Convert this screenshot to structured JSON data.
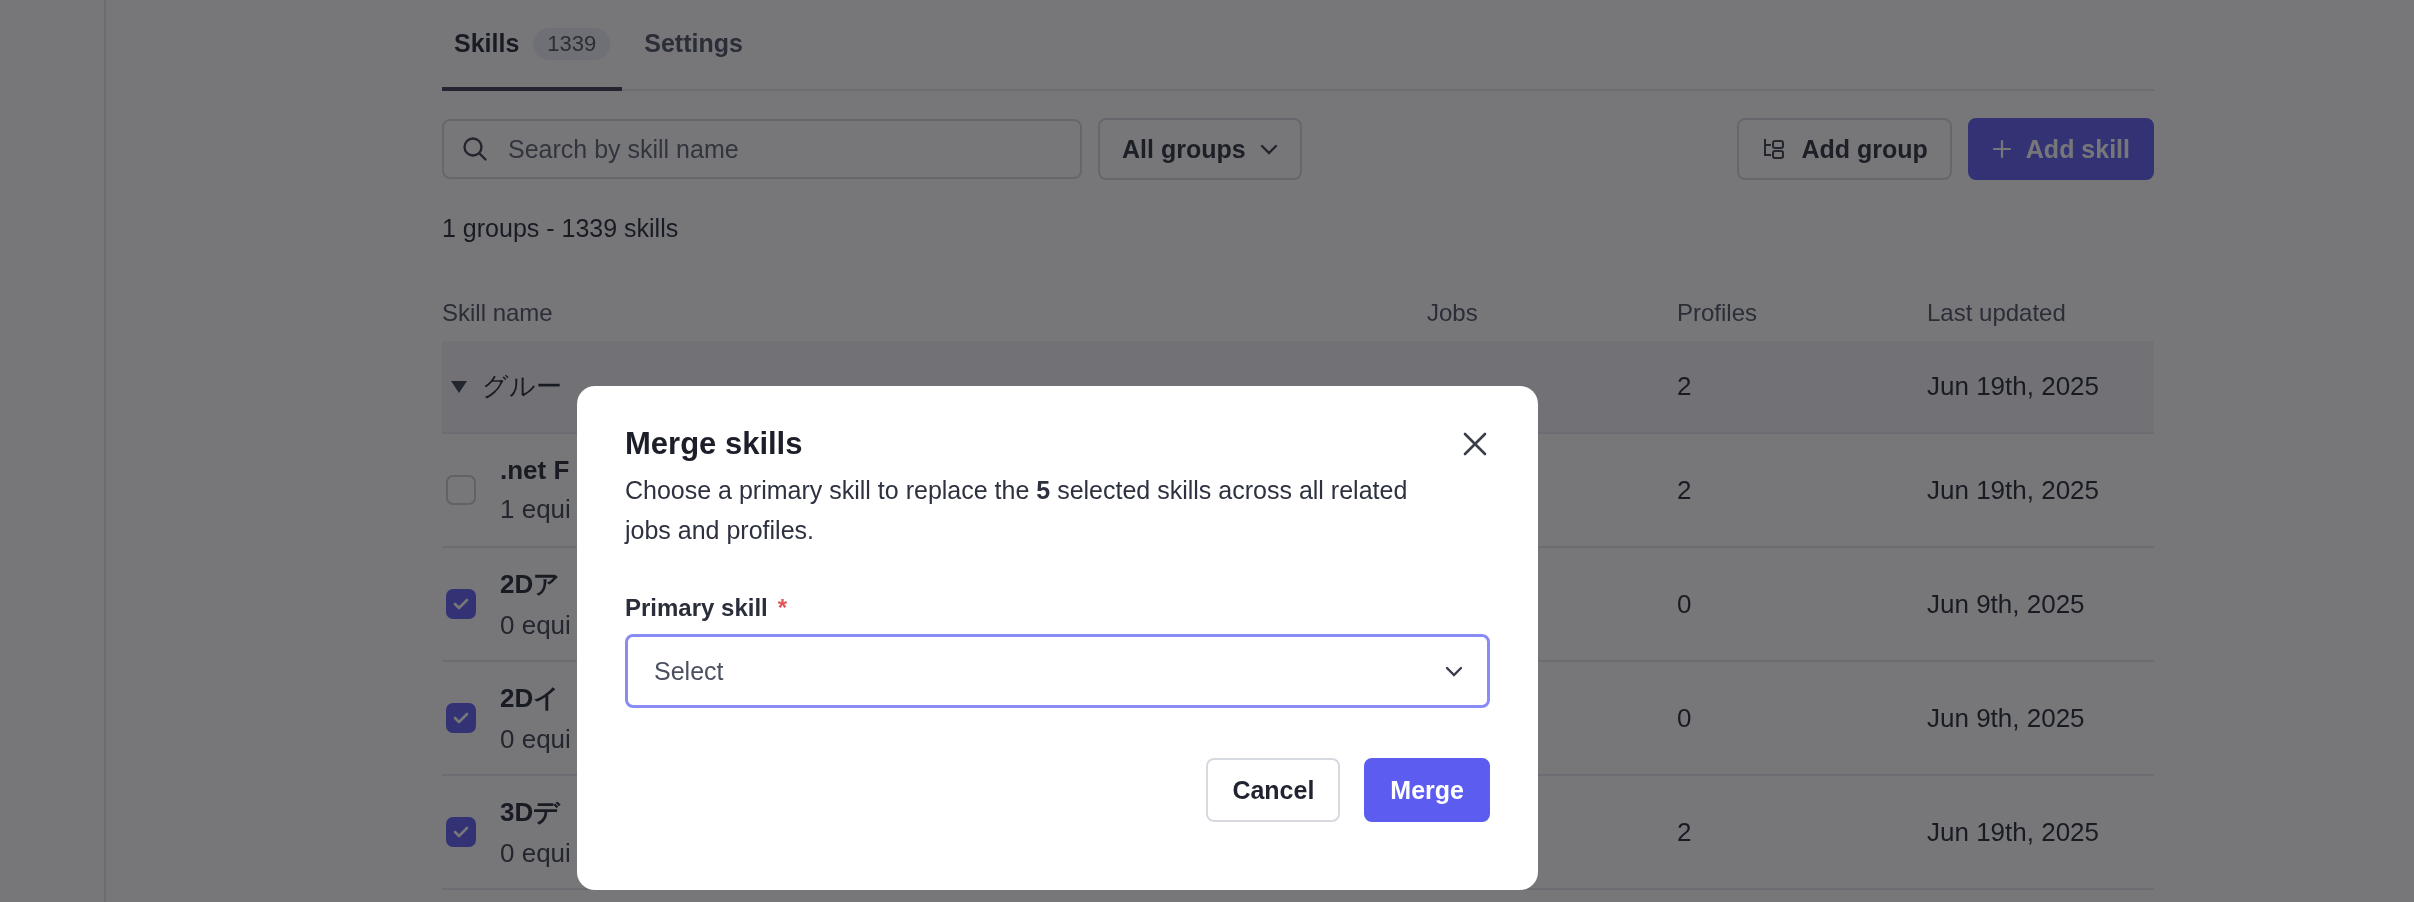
{
  "tabs": [
    {
      "label": "Skills",
      "badge": "1339",
      "selected": true
    },
    {
      "label": "Settings",
      "selected": false
    }
  ],
  "toolbar": {
    "search": {
      "placeholder": "Search by skill name"
    },
    "group_filter": "All groups",
    "add_group": "Add group",
    "add_skill": "Add skill"
  },
  "summary": "1 groups - 1339 skills",
  "table": {
    "columns": [
      "Skill name",
      "Jobs",
      "Profiles",
      "Last updated"
    ],
    "group": {
      "name": "グルー",
      "expanded": true,
      "profiles": "2",
      "last_updated": "Jun 19th, 2025"
    },
    "rows": [
      {
        "name": ".net F",
        "sub": "1 equi",
        "checked": false,
        "profiles": "2",
        "last_updated": "Jun 19th, 2025"
      },
      {
        "name": "2Dア",
        "sub": "0 equi",
        "checked": true,
        "profiles": "0",
        "last_updated": "Jun 9th, 2025"
      },
      {
        "name": "2Dイ",
        "sub": "0 equi",
        "checked": true,
        "profiles": "0",
        "last_updated": "Jun 9th, 2025"
      },
      {
        "name": "3Dデ",
        "sub": "0 equi",
        "checked": true,
        "profiles": "2",
        "last_updated": "Jun 19th, 2025"
      }
    ]
  },
  "dialog": {
    "title": "Merge skills",
    "description": "Choose a primary skill to replace the **5** selected skills across all related jobs and profiles.",
    "field_label": "Primary skill",
    "required_mark": "*",
    "field": {
      "placeholder": "Select",
      "focused": true
    },
    "buttons": [
      {
        "label": "Cancel",
        "kind": "secondary"
      },
      {
        "label": "Merge",
        "kind": "primary"
      }
    ]
  }
}
